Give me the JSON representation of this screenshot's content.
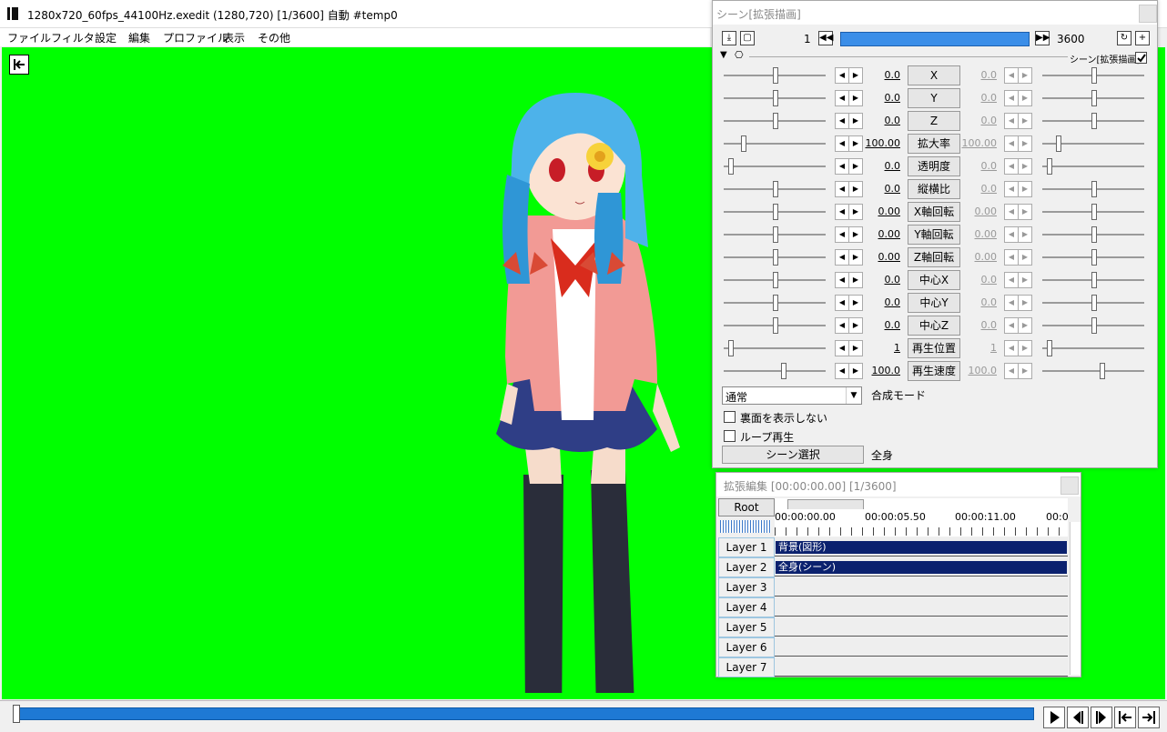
{
  "window": {
    "title": "1280x720_60fps_44100Hz.exedit (1280,720)  [1/3600]  自動  #temp0"
  },
  "menu": [
    "ファイル",
    "フィルタ",
    "設定",
    "編集",
    "プロファイル",
    "表示",
    "その他"
  ],
  "colors": {
    "preview_bg": "#00ff00",
    "seek": "#1e79d4",
    "clip": "#0b216e"
  },
  "playback": {
    "position": 0.0,
    "buttons": [
      "play-icon",
      "prev-frame-icon",
      "next-frame-icon",
      "go-start-icon",
      "go-end-icon"
    ]
  },
  "ext_panel": {
    "title": "シーン[拡張描画]",
    "frame_start": "1",
    "frame_end": "3600",
    "object_label": "シーン[拡張描画]",
    "params": [
      {
        "name": "X",
        "v1": "0.0",
        "v2": "0.0",
        "p1": 0.5,
        "p2": 0.5
      },
      {
        "name": "Y",
        "v1": "0.0",
        "v2": "0.0",
        "p1": 0.5,
        "p2": 0.5
      },
      {
        "name": "Z",
        "v1": "0.0",
        "v2": "0.0",
        "p1": 0.5,
        "p2": 0.5
      },
      {
        "name": "拡大率",
        "v1": "100.00",
        "v2": "100.00",
        "p1": 0.18,
        "p2": 0.14
      },
      {
        "name": "透明度",
        "v1": "0.0",
        "v2": "0.0",
        "p1": 0.05,
        "p2": 0.05
      },
      {
        "name": "縦横比",
        "v1": "0.0",
        "v2": "0.0",
        "p1": 0.5,
        "p2": 0.5
      },
      {
        "name": "X軸回転",
        "v1": "0.00",
        "v2": "0.00",
        "p1": 0.5,
        "p2": 0.5
      },
      {
        "name": "Y軸回転",
        "v1": "0.00",
        "v2": "0.00",
        "p1": 0.5,
        "p2": 0.5
      },
      {
        "name": "Z軸回転",
        "v1": "0.00",
        "v2": "0.00",
        "p1": 0.5,
        "p2": 0.5
      },
      {
        "name": "中心X",
        "v1": "0.0",
        "v2": "0.0",
        "p1": 0.5,
        "p2": 0.5
      },
      {
        "name": "中心Y",
        "v1": "0.0",
        "v2": "0.0",
        "p1": 0.5,
        "p2": 0.5
      },
      {
        "name": "中心Z",
        "v1": "0.0",
        "v2": "0.0",
        "p1": 0.5,
        "p2": 0.5
      },
      {
        "name": "再生位置",
        "v1": "1",
        "v2": "1",
        "p1": 0.05,
        "p2": 0.05
      },
      {
        "name": "再生速度",
        "v1": "100.0",
        "v2": "100.0",
        "p1": 0.58,
        "p2": 0.58
      }
    ],
    "blend_mode_value": "通常",
    "blend_mode_label": "合成モード",
    "hide_back_label": "裏面を表示しない",
    "loop_label": "ループ再生",
    "scene_select_label": "シーン選択",
    "scene_name": "全身"
  },
  "timeline": {
    "title": "拡張編集 [00:00:00.00] [1/3600]",
    "root_label": "Root",
    "times": [
      "00:00:00.00",
      "00:00:05.50",
      "00:00:11.00",
      "00:0"
    ],
    "layers": [
      {
        "label": "Layer 1",
        "clip": "背景(図形)"
      },
      {
        "label": "Layer 2",
        "clip": "全身(シーン)"
      },
      {
        "label": "Layer 3",
        "clip": ""
      },
      {
        "label": "Layer 4",
        "clip": ""
      },
      {
        "label": "Layer 5",
        "clip": ""
      },
      {
        "label": "Layer 6",
        "clip": ""
      },
      {
        "label": "Layer 7",
        "clip": ""
      }
    ]
  }
}
